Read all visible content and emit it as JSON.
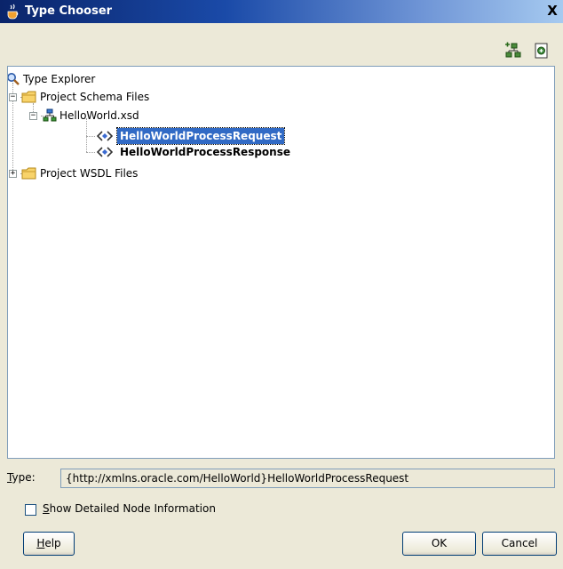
{
  "window": {
    "title": "Type Chooser",
    "close_glyph": "X"
  },
  "toolbar": {
    "icons": [
      "add-schema-icon",
      "import-schema-icon"
    ]
  },
  "tree": {
    "root": "Type Explorer",
    "schema_folder": "Project Schema Files",
    "xsd_file": "HelloWorld.xsd",
    "elements": [
      "HelloWorldProcessRequest",
      "HelloWorldProcessResponse"
    ],
    "wsdl_folder": "Project WSDL Files",
    "selected": "HelloWorldProcessRequest"
  },
  "type_field": {
    "label_underlined": "T",
    "label_rest": "ype:",
    "value": "{http://xmlns.oracle.com/HelloWorld}HelloWorldProcessRequest"
  },
  "checkbox": {
    "label_underlined": "S",
    "label_rest": "how Detailed Node Information",
    "checked": false
  },
  "buttons": {
    "help_underlined": "H",
    "help_rest": "elp",
    "ok": "OK",
    "cancel": "Cancel"
  },
  "colors": {
    "selection": "#316ac5",
    "dialog_bg": "#ece9d8",
    "title_dark": "#0a246a"
  }
}
